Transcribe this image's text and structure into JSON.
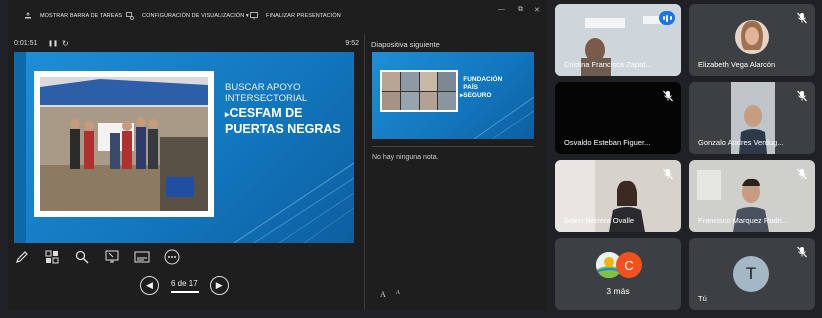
{
  "presenter": {
    "toolbar": {
      "show_taskbar": "MOSTRAR BARRA DE TAREAS",
      "display_settings": "CONFIGURACIÓN DE VISUALIZACIÓN ▾",
      "end_presentation": "FINALIZAR PRESENTACIÓN",
      "window_controls": [
        "—",
        "⧉",
        "✕"
      ]
    },
    "timer": "0:01:51",
    "clock": "9:52",
    "current_slide": {
      "title": "BUSCAR APOYO INTERSECTORIAL",
      "subtitle": "CESFAM de PUERTAS NEGRAS",
      "arrow": "▸"
    },
    "tools": [
      "pen-icon",
      "grid-icon",
      "search-icon",
      "pointer-screen-icon",
      "subtitles-icon",
      "more-icon"
    ],
    "slide_counter": "6 de 17",
    "prev_glyph": "◀",
    "next_glyph": "▶",
    "next_slide_label": "Diapositiva siguiente",
    "next_slide": {
      "title": "FUNDACIÓN PAÍS SEGURO",
      "arrow": "▸"
    },
    "notes": "No hay ninguna nota.",
    "font_buttons": [
      "A",
      "A"
    ]
  },
  "participants": [
    {
      "name": "Cristina Francisca Zapat...",
      "speaking": true
    },
    {
      "name": "Elizabeth Vega Alarcón",
      "muted": true
    },
    {
      "name": "Osvaldo Esteban Figuer...",
      "muted": true
    },
    {
      "name": "Gonzalo Andres Verdug...",
      "muted": true
    },
    {
      "name": "Belen Herrera Ovalle",
      "muted": true
    },
    {
      "name": "Francisco Marquez Rodri...",
      "muted": true
    }
  ],
  "more_tile": {
    "avatar_letter": "C",
    "label": "3 más"
  },
  "self_tile": {
    "avatar_letter": "T",
    "name": "Tú"
  },
  "colors": {
    "slide_blue": "#1275bd",
    "avatar_orange": "#f4511e",
    "self_avatar": "#a3b8c4",
    "speaking": "#1a73e8"
  }
}
